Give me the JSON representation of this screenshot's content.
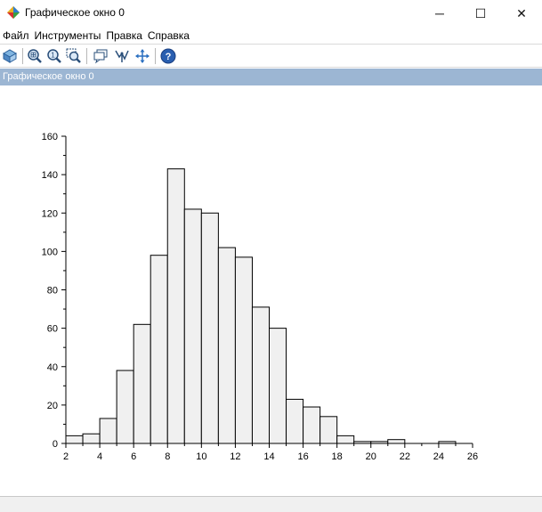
{
  "window": {
    "title": "Графическое окно 0",
    "minimize_glyph": "─",
    "maximize_glyph": "☐",
    "close_glyph": "✕"
  },
  "menu": {
    "items": [
      {
        "label": "Файл"
      },
      {
        "label": "Инструменты"
      },
      {
        "label": "Правка"
      },
      {
        "label": "Справка"
      }
    ]
  },
  "toolbar": {
    "icons": [
      "rotate-icon",
      "zoom-in-icon",
      "zoom-out-icon",
      "zoom-area-icon",
      "datatip-icon",
      "datatip-edit-icon",
      "pan-icon",
      "help-icon"
    ]
  },
  "figure": {
    "caption": "Графическое окно 0"
  },
  "colors": {
    "bar_fill": "#f0f0f0",
    "bar_stroke": "#000000",
    "caption_bg": "#9cb6d3"
  },
  "chart_data": {
    "type": "bar",
    "title": "",
    "xlabel": "",
    "ylabel": "",
    "xlim": [
      2,
      26
    ],
    "ylim": [
      0,
      160
    ],
    "xticks": [
      2,
      4,
      6,
      8,
      10,
      12,
      14,
      16,
      18,
      20,
      22,
      24,
      26
    ],
    "yticks": [
      0,
      20,
      40,
      60,
      80,
      100,
      120,
      140,
      160
    ],
    "bin_edges": [
      2,
      3,
      4,
      5,
      6,
      7,
      8,
      9,
      10,
      11,
      12,
      13,
      14,
      15,
      16,
      17,
      18,
      19,
      20,
      21,
      22,
      23,
      24,
      25,
      26
    ],
    "values": [
      4,
      5,
      13,
      38,
      62,
      98,
      143,
      122,
      120,
      102,
      97,
      71,
      60,
      23,
      19,
      14,
      4,
      1,
      1,
      2,
      0,
      0,
      1,
      0
    ],
    "grid": false,
    "legend": "none"
  }
}
